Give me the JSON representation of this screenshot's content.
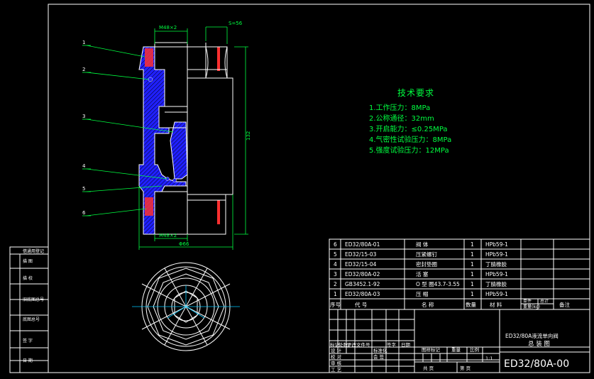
{
  "dimensions": {
    "top_thread": "M48×2",
    "hex_size": "S=56",
    "height": "132",
    "bottom_thread": "M48×2",
    "outer_diameter": "Φ66"
  },
  "callouts": [
    "1",
    "2",
    "3",
    "4",
    "5",
    "6"
  ],
  "tech_requirements": {
    "title": "技术要求",
    "items": [
      "1.工作压力：8MPa",
      "2.公称通径：32mm",
      "3.开启能力：≤0.25MPa",
      "4.气密性试验压力：8MPa",
      "5.强度试验压力：12MPa"
    ]
  },
  "bom": {
    "rows": [
      {
        "no": "6",
        "code": "ED32/80A-01",
        "name": "阀    体",
        "qty": "1",
        "material": "HPb59-1"
      },
      {
        "no": "5",
        "code": "ED32/15-03",
        "name": "压紧螺钉",
        "qty": "1",
        "material": "HPb59-1"
      },
      {
        "no": "4",
        "code": "ED32/15-04",
        "name": "密封垫圈",
        "qty": "1",
        "material": "丁腈橡胶"
      },
      {
        "no": "3",
        "code": "ED32/80A-02",
        "name": "活    塞",
        "qty": "1",
        "material": "HPb59-1"
      },
      {
        "no": "2",
        "code": "GB3452.1-92",
        "name": "O 型 圈43.7-3.55",
        "qty": "1",
        "material": "丁腈橡胶"
      },
      {
        "no": "1",
        "code": "ED32/80A-03",
        "name": "压    帽",
        "qty": "1",
        "material": "HPb59-1"
      }
    ],
    "header": {
      "no": "序号",
      "code": "代    号",
      "name": "名    称",
      "qty": "数量",
      "material": "材    料",
      "single": "单件",
      "total": "总计",
      "weight": "重量(kg)",
      "remark": "备注"
    }
  },
  "title_block": {
    "product": "ED32/80A液流单向阀",
    "drawing_type": "总  装  图",
    "drawing_no": "ED32/80A-00",
    "stage_mark": "图样标记",
    "weight": "重量",
    "scale": "比例",
    "scale_value": "1:1",
    "sheets": "共      页",
    "sheet": "第      页",
    "rev_header": [
      "标记",
      "处数",
      "更改文件号",
      "签字",
      "日期"
    ],
    "roles": [
      "设    计",
      "校    对",
      "审    核",
      "工    艺"
    ],
    "approvals": [
      "标准化",
      "会    签"
    ]
  },
  "left_strip": [
    "借通用登记",
    "描    图",
    "描    校",
    "旧底图总号",
    "底图总号",
    "签    字",
    "日    期"
  ],
  "colors": {
    "background": "#000000",
    "lines": "#ffffff",
    "dimension": "#00ff40",
    "section": "#2020ff",
    "seal": "#ff3030",
    "center": "#00c8ff",
    "text": "#ffffff"
  }
}
